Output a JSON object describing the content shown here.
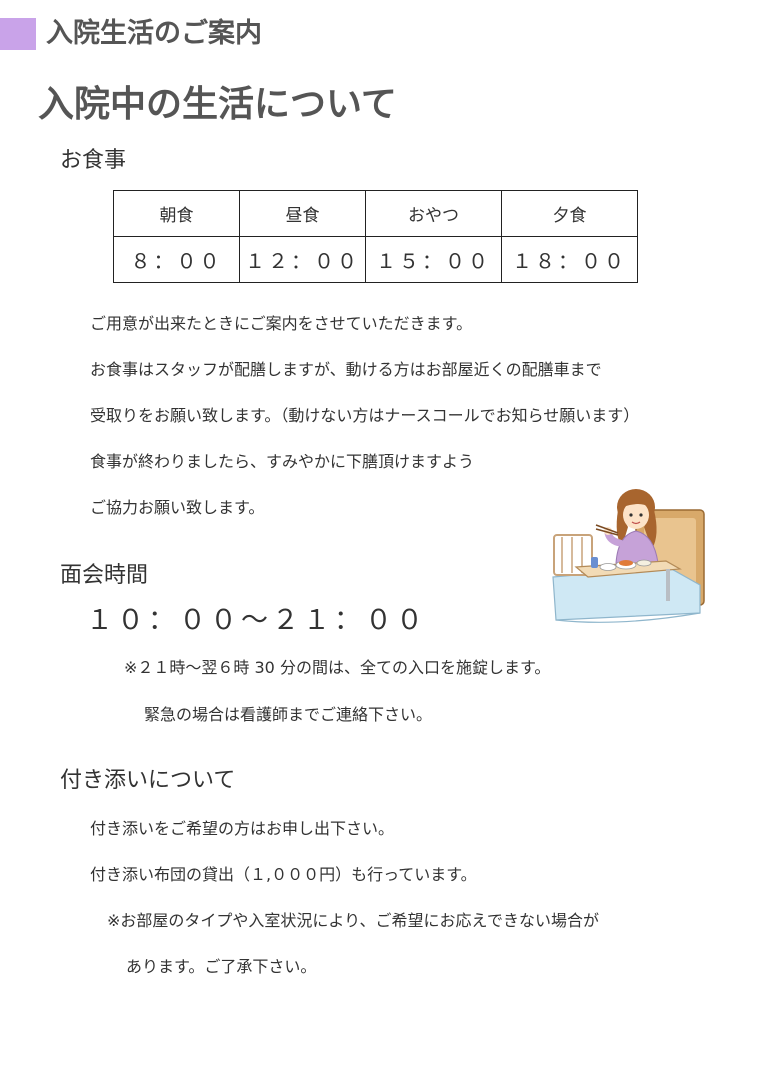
{
  "header": {
    "title": "入院生活のご案内"
  },
  "page_title": "入院中の生活について",
  "meals": {
    "heading": "お食事",
    "columns": [
      "朝食",
      "昼食",
      "おやつ",
      "夕食"
    ],
    "times": [
      "８：００",
      "１２：００",
      "１５：００",
      "１８：００"
    ],
    "paragraphs": [
      "ご用意が出来たときにご案内をさせていただきます。",
      "お食事はスタッフが配膳しますが、動ける方はお部屋近くの配膳車まで",
      "受取りをお願い致します。（動けない方はナースコールでお知らせ願います）",
      "食事が終わりましたら、すみやかに下膳頂けますよう",
      "ご協力お願い致します。"
    ]
  },
  "visiting": {
    "heading": "面会時間",
    "time": "１０：００～２１：００",
    "note1": "※２１時～翌６時 30 分の間は、全ての入口を施錠します。",
    "note2": "緊急の場合は看護師までご連絡下さい。"
  },
  "attendant": {
    "heading": "付き添いについて",
    "line1": "付き添いをご希望の方はお申し出下さい。",
    "line2": "付き添い布団の貸出（１,０００円）も行っています。",
    "note1": "※お部屋のタイプや入室状況により、ご希望にお応えできない場合が",
    "note2": "あります。ご了承下さい。"
  },
  "colors": {
    "accent": "#c9a3e9",
    "heading": "#555555",
    "text": "#333333"
  },
  "illustration": {
    "icon": "patient-eating-in-bed-illustration"
  }
}
